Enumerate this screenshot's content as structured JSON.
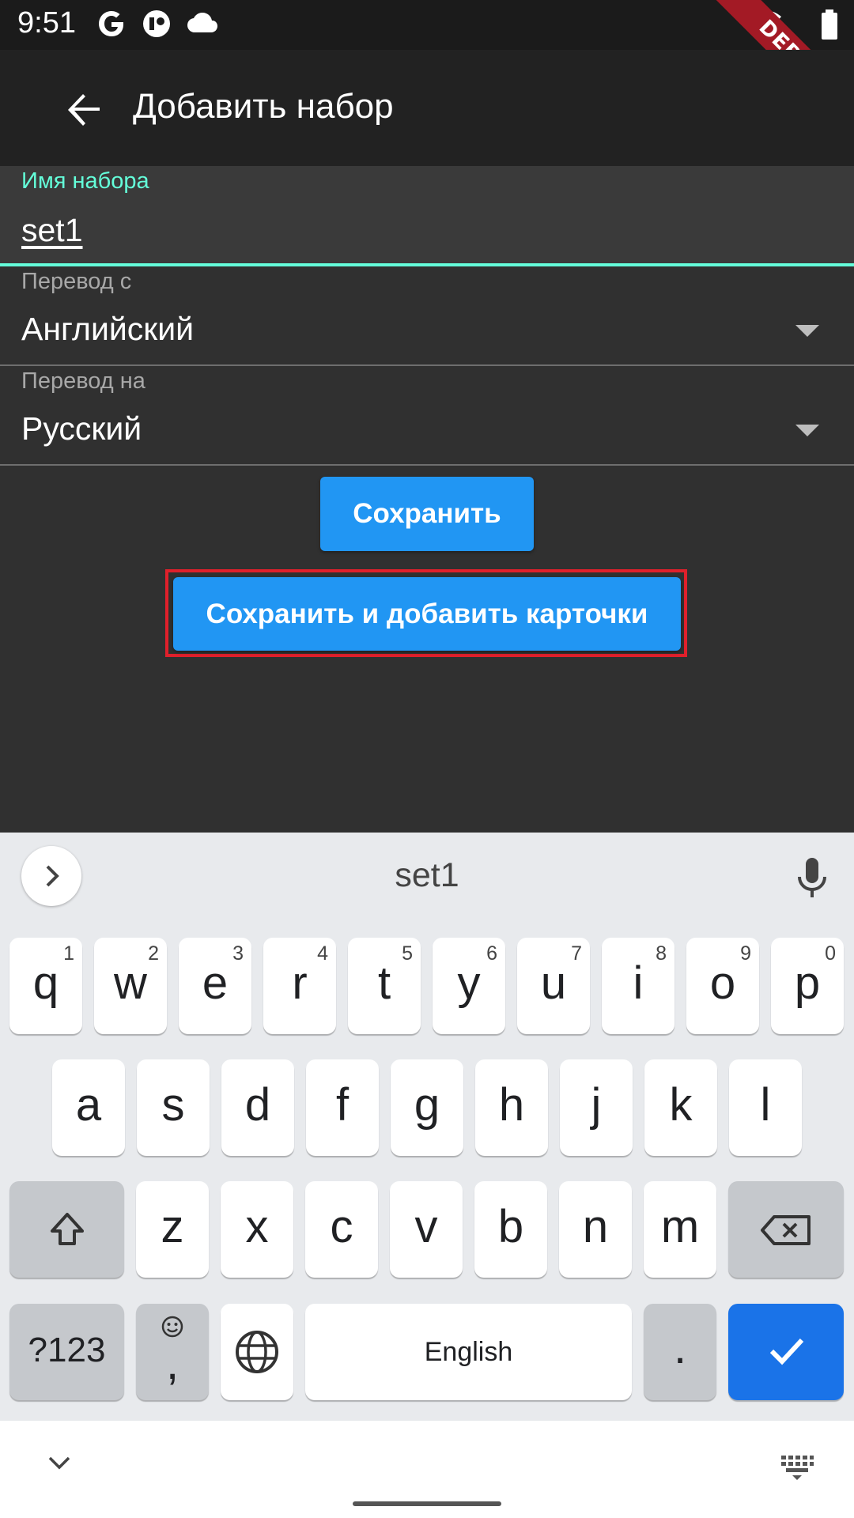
{
  "status_bar": {
    "time": "9:51",
    "icons": [
      "google-icon",
      "notification-app-icon",
      "cloud-icon",
      "wifi-icon",
      "battery-icon"
    ],
    "debug_banner": "DEBUG"
  },
  "app_bar": {
    "back_icon": "arrow-back-icon",
    "title": "Добавить набор"
  },
  "form": {
    "name_field": {
      "label": "Имя набора",
      "value": "set1"
    },
    "from_field": {
      "label": "Перевод с",
      "value": "Английский"
    },
    "to_field": {
      "label": "Перевод на",
      "value": "Русский"
    },
    "save_button": "Сохранить",
    "save_add_button": "Сохранить и добавить карточки"
  },
  "colors": {
    "accent": "#64ffda",
    "button": "#2196f3",
    "highlight": "#e0202b",
    "background": "#303030",
    "app_bar": "#222222"
  },
  "keyboard": {
    "suggestion": "set1",
    "row1": [
      {
        "k": "q",
        "h": "1"
      },
      {
        "k": "w",
        "h": "2"
      },
      {
        "k": "e",
        "h": "3"
      },
      {
        "k": "r",
        "h": "4"
      },
      {
        "k": "t",
        "h": "5"
      },
      {
        "k": "y",
        "h": "6"
      },
      {
        "k": "u",
        "h": "7"
      },
      {
        "k": "i",
        "h": "8"
      },
      {
        "k": "o",
        "h": "9"
      },
      {
        "k": "p",
        "h": "0"
      }
    ],
    "row2": [
      "a",
      "s",
      "d",
      "f",
      "g",
      "h",
      "j",
      "k",
      "l"
    ],
    "row3": [
      "z",
      "x",
      "c",
      "v",
      "b",
      "n",
      "m"
    ],
    "symbols_key": "?123",
    "comma_key": ",",
    "space_key": "English",
    "period_key": ".",
    "icons": [
      "expand-icon",
      "mic-icon",
      "shift-icon",
      "backspace-icon",
      "emoji-icon",
      "globe-icon",
      "done-check-icon",
      "hide-keyboard-icon",
      "keyboard-switch-icon"
    ]
  }
}
